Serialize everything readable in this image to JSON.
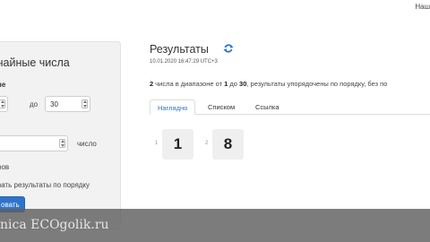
{
  "header": {
    "corner_link": "Наш"
  },
  "sidebar": {
    "title": "чайные числа",
    "range_label": "не",
    "from_value": "",
    "to_label": "до",
    "to_value": "30",
    "count_value": "",
    "count_suffix": "число",
    "option_unique": "ров",
    "option_sorted": "вать результаты по порядку",
    "submit_label": "овать"
  },
  "results": {
    "title": "Результаты",
    "timestamp": "10.01.2020 16:47:29 UTC+3",
    "summary": {
      "count": "2",
      "part1": " числа в диапазоне от ",
      "from": "1",
      "part2": " до ",
      "to": "30",
      "part3": ", результаты упорядочены по порядку, без по"
    },
    "tabs": [
      {
        "label": "Наглядно",
        "active": true
      },
      {
        "label": "Списком",
        "active": false
      },
      {
        "label": "Ссылка",
        "active": false
      }
    ],
    "numbers": [
      {
        "index": "1",
        "value": "1"
      },
      {
        "index": "2",
        "value": "8"
      }
    ]
  },
  "watermark": {
    "text": "nica ECOgolik.ru"
  },
  "colors": {
    "accent": "#2f74c9",
    "panel_bg": "#f2f2f2",
    "number_box": "#efefef"
  },
  "icons": {
    "refresh": "refresh-icon",
    "spinner": "spinner-arrows-icon"
  }
}
